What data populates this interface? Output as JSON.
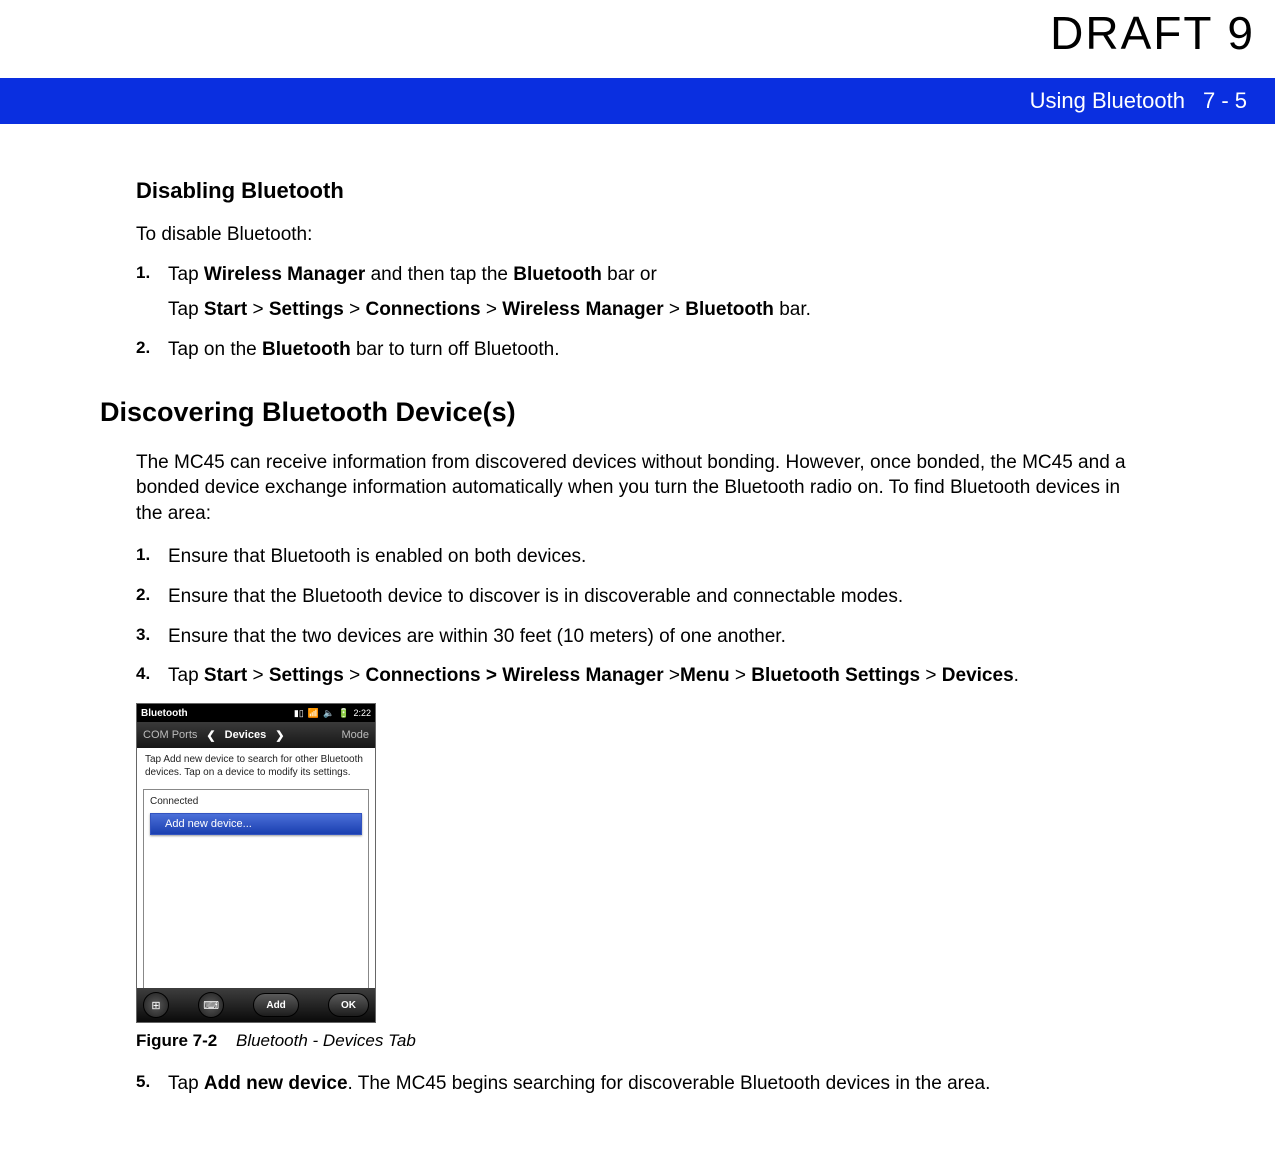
{
  "draft": "DRAFT 9",
  "header": {
    "chapter": "Using Bluetooth",
    "page": "7 - 5"
  },
  "section1": {
    "title": "Disabling Bluetooth",
    "intro": "To disable Bluetooth:",
    "steps": [
      {
        "num": "1.",
        "parts": [
          {
            "t": "Tap "
          },
          {
            "t": "Wireless Manager",
            "b": true
          },
          {
            "t": " and then tap the "
          },
          {
            "t": "Bluetooth",
            "b": true
          },
          {
            "t": " bar or"
          }
        ],
        "subline": [
          {
            "t": "Tap "
          },
          {
            "t": "Start",
            "b": true
          },
          {
            "t": " > "
          },
          {
            "t": "Settings",
            "b": true
          },
          {
            "t": " > "
          },
          {
            "t": "Connections",
            "b": true
          },
          {
            "t": " > "
          },
          {
            "t": "Wireless Manager",
            "b": true
          },
          {
            "t": " > "
          },
          {
            "t": "Bluetooth",
            "b": true
          },
          {
            "t": " bar."
          }
        ]
      },
      {
        "num": "2.",
        "parts": [
          {
            "t": "Tap on the "
          },
          {
            "t": "Bluetooth",
            "b": true
          },
          {
            "t": " bar to turn off Bluetooth."
          }
        ]
      }
    ]
  },
  "section2": {
    "title": "Discovering Bluetooth Device(s)",
    "intro": "The MC45 can receive information from discovered devices without bonding. However, once bonded, the MC45 and a bonded device exchange information automatically when you turn the Bluetooth radio on. To find Bluetooth devices in the area:",
    "steps": [
      {
        "num": "1.",
        "text": "Ensure that Bluetooth is enabled on both devices."
      },
      {
        "num": "2.",
        "text": "Ensure that the Bluetooth device to discover is in discoverable and connectable modes."
      },
      {
        "num": "3.",
        "text": "Ensure that the two devices are within 30 feet (10 meters) of one another."
      },
      {
        "num": "4.",
        "parts": [
          {
            "t": "Tap "
          },
          {
            "t": "Start",
            "b": true
          },
          {
            "t": " > "
          },
          {
            "t": "Settings",
            "b": true
          },
          {
            "t": " > "
          },
          {
            "t": "Connections > Wireless Manager ",
            "b": true
          },
          {
            "t": ">"
          },
          {
            "t": "Menu",
            "b": true
          },
          {
            "t": " > "
          },
          {
            "t": "Bluetooth Settings",
            "b": true
          },
          {
            "t": " > "
          },
          {
            "t": "Devices",
            "b": true
          },
          {
            "t": "."
          }
        ]
      }
    ],
    "step5": {
      "num": "5.",
      "parts": [
        {
          "t": "Tap "
        },
        {
          "t": "Add new device",
          "b": true
        },
        {
          "t": ". The MC45 begins searching for discoverable Bluetooth devices in the area."
        }
      ]
    }
  },
  "screenshot": {
    "status_title": "Bluetooth",
    "time": "2:22",
    "tabs": {
      "left": "COM Ports",
      "center": "Devices",
      "right": "Mode"
    },
    "help_text": "Tap Add new device to search for other Bluetooth devices. Tap on a device to modify its settings.",
    "group_label": "Connected",
    "add_item": "Add new device...",
    "bottom": {
      "add": "Add",
      "ok": "OK"
    }
  },
  "figure": {
    "label": "Figure 7-2",
    "caption": "Bluetooth - Devices Tab"
  }
}
